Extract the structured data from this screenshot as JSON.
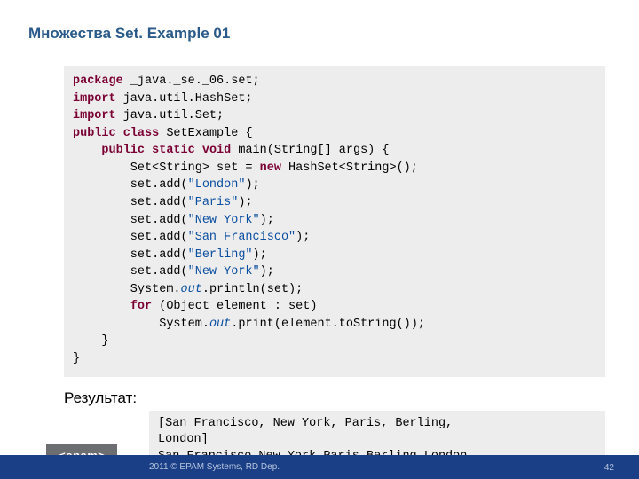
{
  "title": "Множества Set. Example 01",
  "code_tokens": [
    {
      "t": "package",
      "c": "kw"
    },
    {
      "t": " _java._se._06.set;\n"
    },
    {
      "t": "import",
      "c": "kw"
    },
    {
      "t": " java.util.HashSet;\n"
    },
    {
      "t": "import",
      "c": "kw"
    },
    {
      "t": " java.util.Set;\n"
    },
    {
      "t": "public",
      "c": "kw"
    },
    {
      "t": " "
    },
    {
      "t": "class",
      "c": "kw"
    },
    {
      "t": " SetExample {\n"
    },
    {
      "t": "    "
    },
    {
      "t": "public",
      "c": "kw"
    },
    {
      "t": " "
    },
    {
      "t": "static",
      "c": "kw"
    },
    {
      "t": " "
    },
    {
      "t": "void",
      "c": "kw"
    },
    {
      "t": " main(String[] args) {\n"
    },
    {
      "t": "        Set<String> set = "
    },
    {
      "t": "new",
      "c": "kw"
    },
    {
      "t": " HashSet<String>();\n"
    },
    {
      "t": "        set.add("
    },
    {
      "t": "\"London\"",
      "c": "str"
    },
    {
      "t": ");\n"
    },
    {
      "t": "        set.add("
    },
    {
      "t": "\"Paris\"",
      "c": "str"
    },
    {
      "t": ");\n"
    },
    {
      "t": "        set.add("
    },
    {
      "t": "\"New York\"",
      "c": "str"
    },
    {
      "t": ");\n"
    },
    {
      "t": "        set.add("
    },
    {
      "t": "\"San Francisco\"",
      "c": "str"
    },
    {
      "t": ");\n"
    },
    {
      "t": "        set.add("
    },
    {
      "t": "\"Berling\"",
      "c": "str"
    },
    {
      "t": ");\n"
    },
    {
      "t": "        set.add("
    },
    {
      "t": "\"New York\"",
      "c": "str"
    },
    {
      "t": ");\n"
    },
    {
      "t": "        System."
    },
    {
      "t": "out",
      "c": "fld"
    },
    {
      "t": ".println(set);\n"
    },
    {
      "t": "        "
    },
    {
      "t": "for",
      "c": "kw"
    },
    {
      "t": " (Object element : set)\n"
    },
    {
      "t": "            System."
    },
    {
      "t": "out",
      "c": "fld"
    },
    {
      "t": ".print(element.toString());\n"
    },
    {
      "t": "    }\n"
    },
    {
      "t": "}"
    }
  ],
  "result_label": "Результат:",
  "output_lines": [
    "[San Francisco, New York, Paris, Berling,",
    "London]",
    "San Francisco New York Paris Berling London"
  ],
  "footer": {
    "logo": "<epam>",
    "copyright": "2011 © EPAM Systems, RD Dep.",
    "page": "42"
  }
}
